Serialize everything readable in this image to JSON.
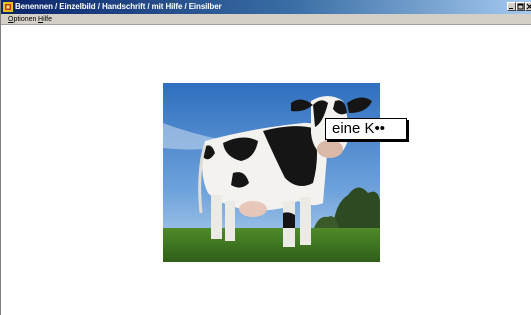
{
  "window": {
    "title": "Benennen / Einzelbild / Handschrift / mit Hilfe / Einsilber",
    "icon": "app-icon"
  },
  "menu": {
    "items": [
      {
        "label_underlined": "O",
        "label_rest": "ptionen"
      },
      {
        "label_underlined": "H",
        "label_rest": "ilfe"
      }
    ]
  },
  "main": {
    "image": {
      "subject": "cow",
      "icon": "cow-photo"
    },
    "answer_label": "eine K••"
  },
  "colors": {
    "titlebar_start": "#0a246a",
    "titlebar_end": "#a6caf0",
    "menubar": "#d4d0c8",
    "background": "#ffffff"
  }
}
